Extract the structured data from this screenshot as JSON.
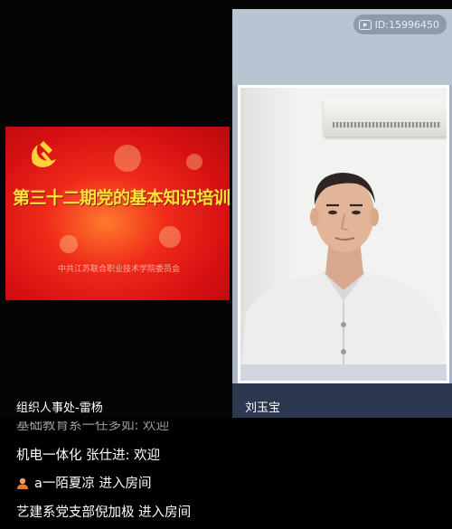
{
  "left_panel": {
    "presenter_name": "组织人事处-雷杨",
    "slide": {
      "title": "第三十二期党的基本知识培训班开班典礼",
      "subtitle": "中共江苏联合职业技术学院委员会"
    }
  },
  "right_panel": {
    "room_id": "ID:15996450",
    "participant_name": "刘玉宝"
  },
  "chat": {
    "messages": [
      {
        "text": "基础教育系一任多如: 欢迎",
        "faded": true
      },
      {
        "text": "机电一体化 张仕进: 欢迎",
        "faded": false
      },
      {
        "text": "a一陌夏凉 进入房间",
        "faded": false,
        "icon": "user-icon"
      },
      {
        "text": "艺建系党支部倪加极 进入房间",
        "faded": false
      }
    ]
  },
  "colors": {
    "slide_red": "#d61012",
    "slide_title_yellow": "#ffe23a",
    "background": "#050506"
  }
}
